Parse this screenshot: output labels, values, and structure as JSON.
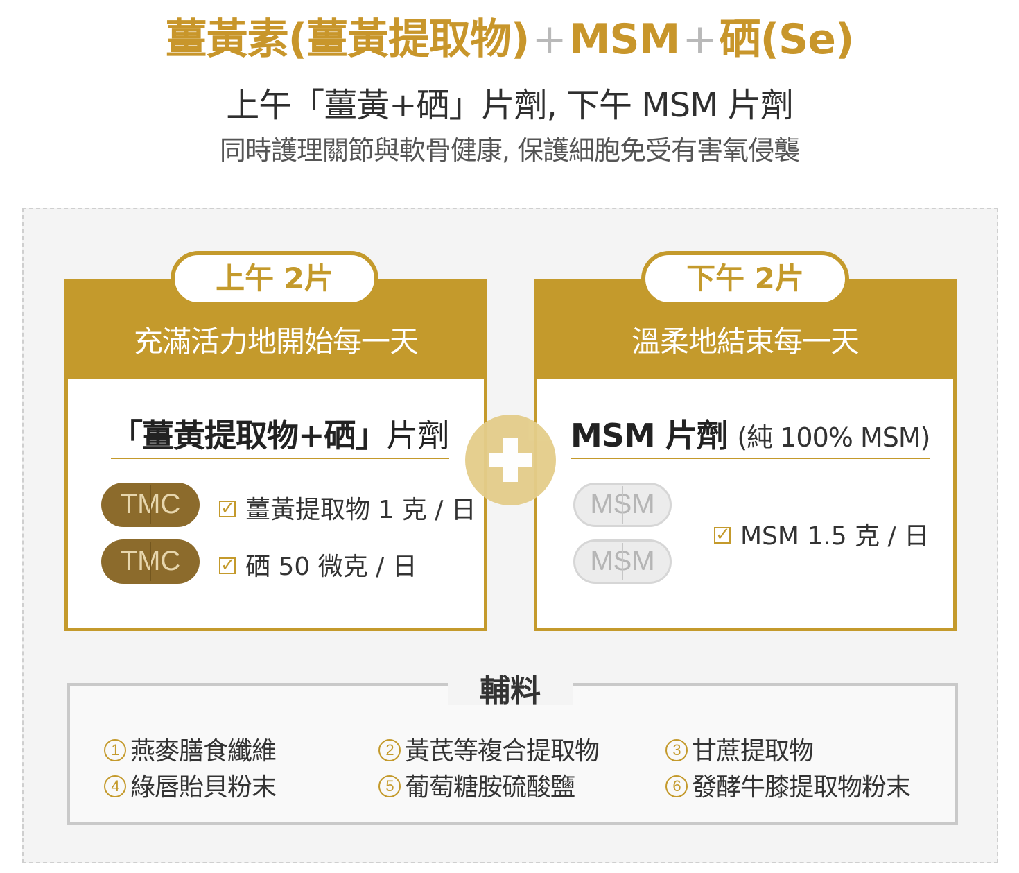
{
  "header": {
    "title_part1": "薑黃素(薑黃提取物)",
    "plus1": "+",
    "title_part2": "MSM",
    "plus2": "+",
    "title_part3": "硒(Se)",
    "subtitle": "上午「薑黃+硒」片劑, 下午 MSM 片劑",
    "description": "同時護理關節與軟骨健康, 保護細胞免受有害氧侵襲"
  },
  "morning": {
    "tab_label": "上午 2片",
    "slogan": "充滿活力地開始每一天",
    "product_title_bold": "「薑黃提取物+硒」",
    "product_title_light": "片劑",
    "pill_label_1": "TMC",
    "pill_label_2": "TMC",
    "item_1": "薑黃提取物 1 克 / 日",
    "item_2": "硒 50 微克 / 日"
  },
  "evening": {
    "tab_label": "下午 2片",
    "slogan": "溫柔地結束每一天",
    "product_title_bold": "MSM 片劑",
    "product_title_note": "(純 100% MSM)",
    "pill_label_1": "MSM",
    "pill_label_2": "MSM",
    "item_1": "MSM 1.5 克 / 日"
  },
  "excipients": {
    "title": "輔料",
    "items": [
      {
        "num": "1",
        "text": "燕麥膳食纖維"
      },
      {
        "num": "2",
        "text": "黃芪等複合提取物"
      },
      {
        "num": "3",
        "text": "甘蔗提取物"
      },
      {
        "num": "4",
        "text": "綠唇貽貝粉末"
      },
      {
        "num": "5",
        "text": "葡萄糖胺硫酸鹽"
      },
      {
        "num": "6",
        "text": "發酵牛膝提取物粉末"
      }
    ]
  },
  "colors": {
    "accent_gold": "#c49a2c",
    "title_gold": "#c8962b",
    "pill_brown": "#8c6b2c"
  }
}
